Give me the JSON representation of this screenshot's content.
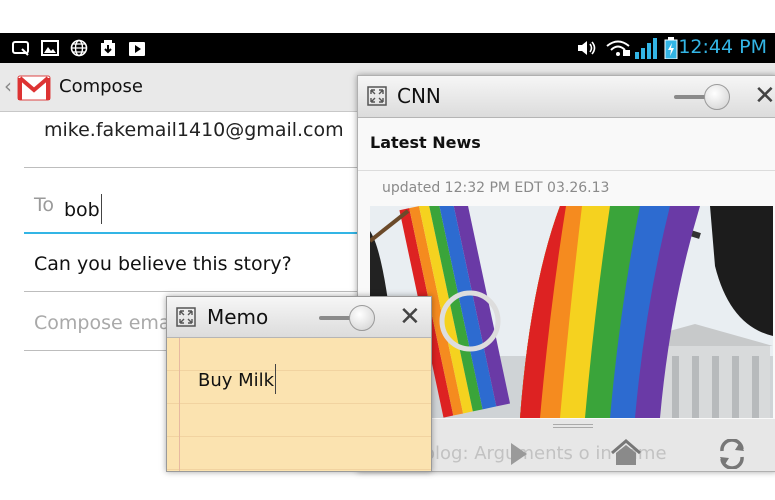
{
  "status_bar": {
    "clock": "12:44 PM",
    "left_icons": [
      "notification-icon",
      "gallery-icon",
      "globe-icon",
      "download-icon",
      "play-store-icon"
    ],
    "right_icons": [
      "volume-icon",
      "wifi-icon",
      "signal-icon",
      "battery-charging-icon"
    ],
    "accent_color": "#33b5e5"
  },
  "compose": {
    "title": "Compose",
    "from": "mike.fakemail1410@gmail.com",
    "to_label": "To",
    "to_value": "bob",
    "subject": "Can you believe this story?",
    "body_placeholder": "Compose ema"
  },
  "cnn_window": {
    "title": "CNN",
    "heading": "Latest News",
    "updated": "updated 12:32 PM EDT 03.26.13",
    "ticker_text": "olog: Arguments o   in same"
  },
  "memo_window": {
    "title": "Memo",
    "text": "Buy Milk"
  }
}
